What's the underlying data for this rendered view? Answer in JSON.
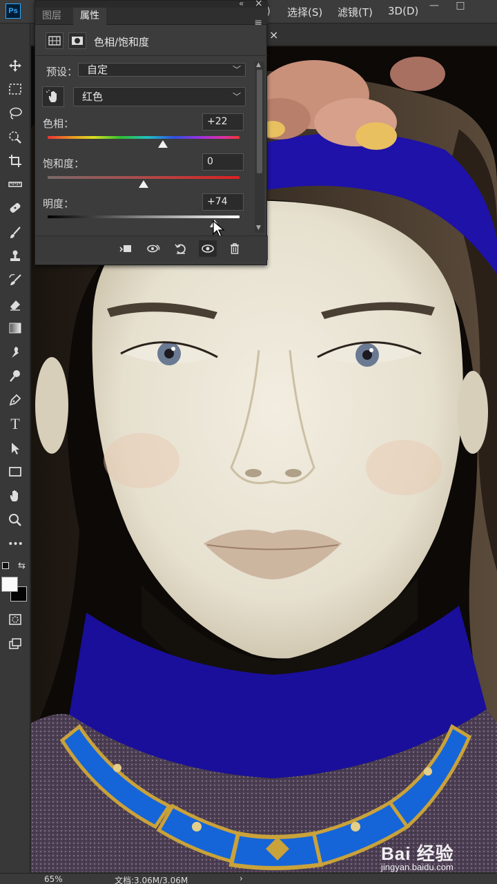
{
  "app": {
    "logo": "Ps"
  },
  "menu": [
    {
      "label": ")"
    },
    {
      "label": "选择(S)"
    },
    {
      "label": "滤镜(T)"
    },
    {
      "label": "3D(D)"
    }
  ],
  "window_controls": {
    "minimize": "—",
    "maximize": "□"
  },
  "document_tab": {
    "close": "×"
  },
  "toolbar": {
    "tools": [
      "move-tool-icon",
      "marquee-tool-icon",
      "lasso-tool-icon",
      "quick-selection-icon",
      "crop-tool-icon",
      "ruler-tool-icon",
      "healing-brush-icon",
      "brush-tool-icon",
      "stamp-tool-icon",
      "history-brush-icon",
      "eraser-tool-icon",
      "gradient-tool-icon",
      "smudge-tool-icon",
      "dodge-tool-icon",
      "pen-tool-icon",
      "type-tool-icon",
      "path-selection-icon",
      "rectangle-tool-icon",
      "hand-tool-icon",
      "zoom-tool-icon",
      "more-tools-icon"
    ],
    "type_glyph": "T",
    "more_glyph": "•••"
  },
  "panel": {
    "tabs": [
      {
        "label": "图层"
      },
      {
        "label": "属性"
      }
    ],
    "active_tab": "属性",
    "title": "色相/饱和度",
    "preset_label": "预设：",
    "preset_value": "自定",
    "channel_value": "红色",
    "sliders": [
      {
        "label": "色相：",
        "value": "+22",
        "fraction": 0.6
      },
      {
        "label": "饱和度：",
        "value": "0",
        "fraction": 0.5
      },
      {
        "label": "明度：",
        "value": "+74",
        "fraction": 0.87
      }
    ]
  },
  "colors": {
    "panel_bg": "#3c3c3c",
    "headband_blue": "#1f12a8",
    "collar_blue": "#1a0f9a",
    "necklace_blue": "#1565d8",
    "gold": "#c9a23a",
    "skin": "#e8e2d0"
  },
  "status": {
    "zoom": "65%",
    "doc_info": "文档:3.06M/3.06M",
    "arrow": "›"
  },
  "watermark": {
    "main": "Bai 经验",
    "sub": "jingyan.baidu.com"
  }
}
